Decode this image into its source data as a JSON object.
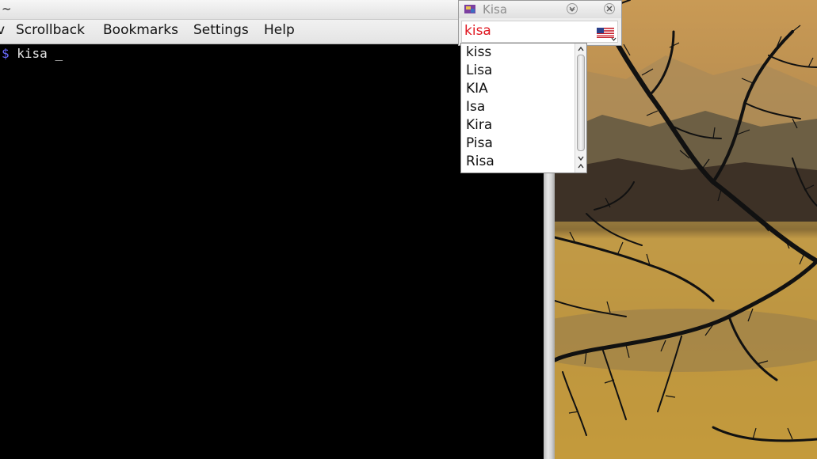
{
  "terminal": {
    "title": "~",
    "menu": [
      "v",
      "Scrollback",
      "Bookmarks",
      "Settings",
      "Help"
    ],
    "prompt_symbol": "$",
    "command": "kisa _"
  },
  "kisa": {
    "title": "Kisa",
    "input_value": "kisa",
    "input_color": "#e0141e",
    "language_icon": "us-flag-icon",
    "suggestions": [
      "kiss",
      "Lisa",
      "KIA",
      "Isa",
      "Kira",
      "Pisa",
      "Risa"
    ]
  }
}
